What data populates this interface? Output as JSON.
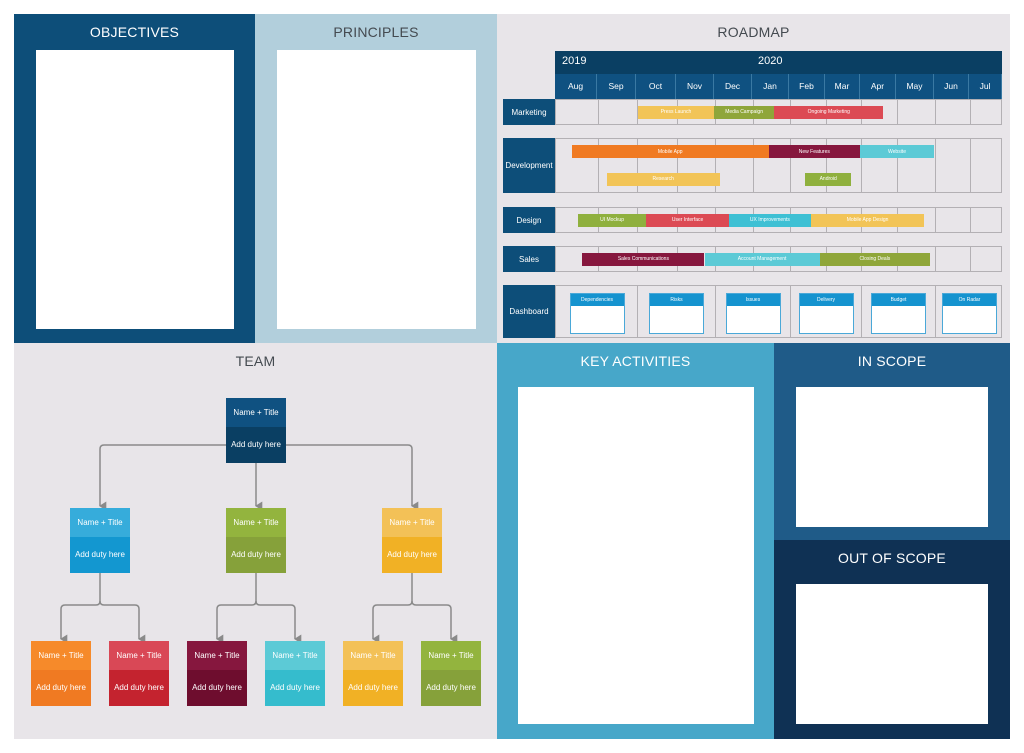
{
  "panels": {
    "objectives": {
      "title": "OBJECTIVES"
    },
    "principles": {
      "title": "PRINCIPLES"
    },
    "roadmap": {
      "title": "ROADMAP"
    },
    "team": {
      "title": "TEAM"
    },
    "key_activities": {
      "title": "KEY ACTIVITIES"
    },
    "in_scope": {
      "title": "IN SCOPE"
    },
    "out_of_scope": {
      "title": "OUT OF SCOPE"
    }
  },
  "roadmap": {
    "years": [
      {
        "label": "2019",
        "start_month_index": 0
      },
      {
        "label": "2020",
        "start_month_index": 5
      }
    ],
    "months": [
      "Aug",
      "Sep",
      "Oct",
      "Nov",
      "Dec",
      "Jan",
      "Feb",
      "Mar",
      "Apr",
      "May",
      "Jun",
      "Jul"
    ],
    "rows": [
      {
        "label": "Marketing",
        "lanes": 1,
        "bars": [
          {
            "label": "Press Launch",
            "start": 2.05,
            "end": 4.0,
            "lane": 0,
            "color": "#f2c457"
          },
          {
            "label": "Media Campaign",
            "start": 4.0,
            "end": 5.6,
            "lane": 0,
            "color": "#8fa63a"
          },
          {
            "label": "Ongoing Marketing",
            "start": 5.6,
            "end": 8.65,
            "lane": 0,
            "color": "#dc4a54"
          }
        ]
      },
      {
        "label": "Development",
        "lanes": 2,
        "bars": [
          {
            "label": "Mobile App",
            "start": 0.4,
            "end": 5.45,
            "lane": 0,
            "color": "#f07a22"
          },
          {
            "label": "New Features",
            "start": 5.45,
            "end": 8.0,
            "lane": 0,
            "color": "#86173e"
          },
          {
            "label": "Website",
            "start": 8.0,
            "end": 10.0,
            "lane": 0,
            "color": "#5ccad6"
          },
          {
            "label": "Research",
            "start": 1.25,
            "end": 4.15,
            "lane": 1,
            "color": "#f2c457"
          },
          {
            "label": "Android",
            "start": 6.45,
            "end": 7.75,
            "lane": 1,
            "color": "#8fb03e"
          }
        ]
      },
      {
        "label": "Design",
        "lanes": 1,
        "bars": [
          {
            "label": "UI Mockup",
            "start": 0.55,
            "end": 2.25,
            "lane": 0,
            "color": "#8fb03e"
          },
          {
            "label": "User Interface",
            "start": 2.25,
            "end": 4.4,
            "lane": 0,
            "color": "#dc4a54"
          },
          {
            "label": "UX Improvements",
            "start": 4.4,
            "end": 6.6,
            "lane": 0,
            "color": "#3ec0d4"
          },
          {
            "label": "Mobile App Design",
            "start": 6.6,
            "end": 9.75,
            "lane": 0,
            "color": "#f2c457"
          }
        ]
      },
      {
        "label": "Sales",
        "lanes": 1,
        "bars": [
          {
            "label": "Sales Communications",
            "start": 0.65,
            "end": 3.75,
            "lane": 0,
            "color": "#86173e"
          },
          {
            "label": "Account Management",
            "start": 3.75,
            "end": 6.85,
            "lane": 0,
            "color": "#5ccad6"
          },
          {
            "label": "Closing Deals",
            "start": 6.85,
            "end": 9.9,
            "lane": 0,
            "color": "#8fa63a"
          }
        ]
      }
    ],
    "dashboard": {
      "label": "Dashboard",
      "cards": [
        "Dependencies",
        "Risks",
        "Issues",
        "Delivery",
        "Budget",
        "On Radar"
      ]
    }
  },
  "team": {
    "root": {
      "title": "Name + Title",
      "duty": "Add duty here",
      "top_color": "#0f5181",
      "bottom_color": "#0a3f63"
    },
    "managers": [
      {
        "title": "Name + Title",
        "duty": "Add duty here",
        "top_color": "#36acdb",
        "bottom_color": "#1397d0",
        "reports": [
          {
            "title": "Name + Title",
            "duty": "Add duty here",
            "top_color": "#f68a2a",
            "bottom_color": "#f07a22"
          },
          {
            "title": "Name + Title",
            "duty": "Add duty here",
            "top_color": "#d94856",
            "bottom_color": "#c4232f"
          }
        ]
      },
      {
        "title": "Name + Title",
        "duty": "Add duty here",
        "top_color": "#93b43e",
        "bottom_color": "#86a13a",
        "reports": [
          {
            "title": "Name + Title",
            "duty": "Add duty here",
            "top_color": "#86173e",
            "bottom_color": "#6e0d2e"
          },
          {
            "title": "Name + Title",
            "duty": "Add duty here",
            "top_color": "#5ccad6",
            "bottom_color": "#35bccd"
          }
        ]
      },
      {
        "title": "Name + Title",
        "duty": "Add duty here",
        "top_color": "#f3c157",
        "bottom_color": "#f1b125",
        "reports": [
          {
            "title": "Name + Title",
            "duty": "Add duty here",
            "top_color": "#f3c157",
            "bottom_color": "#f1b125"
          },
          {
            "title": "Name + Title",
            "duty": "Add duty here",
            "top_color": "#93b43e",
            "bottom_color": "#86a13a"
          }
        ]
      }
    ]
  }
}
